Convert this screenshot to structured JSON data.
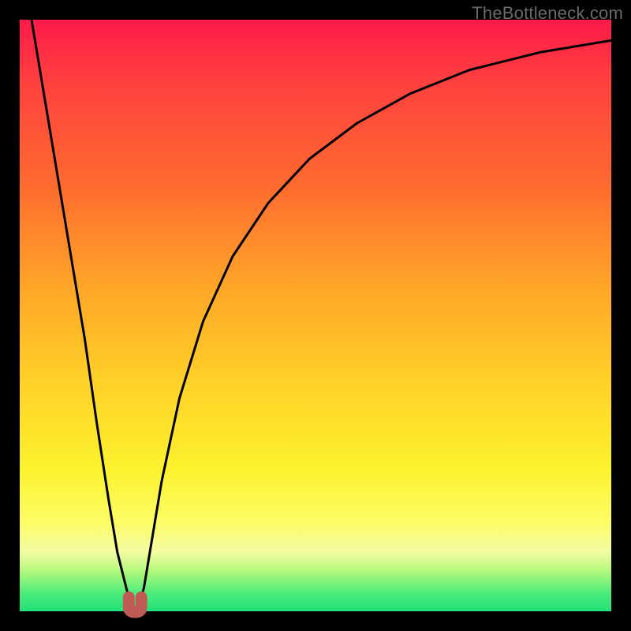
{
  "watermark": "TheBottleneck.com",
  "chart_data": {
    "type": "line",
    "title": "",
    "xlabel": "",
    "ylabel": "",
    "xlim": [
      0,
      100
    ],
    "ylim": [
      0,
      100
    ],
    "grid": false,
    "series": [
      {
        "name": "bottleneck-curve",
        "x": [
          2,
          5,
          8,
          11,
          13,
          15,
          16.5,
          18,
          18.8,
          19.5,
          20.2,
          21,
          22,
          24,
          27,
          31,
          36,
          42,
          49,
          57,
          66,
          76,
          88,
          100
        ],
        "y": [
          100,
          82,
          64,
          46,
          32,
          19,
          10,
          4,
          1,
          0.5,
          1,
          4,
          10,
          22,
          36,
          49,
          60,
          69,
          76.5,
          82.5,
          87.5,
          91.5,
          94.5,
          96.5
        ]
      }
    ],
    "marker": {
      "name": "optimal-marker",
      "x": 19.5,
      "y": 0.5,
      "color": "#bf5a55"
    }
  }
}
